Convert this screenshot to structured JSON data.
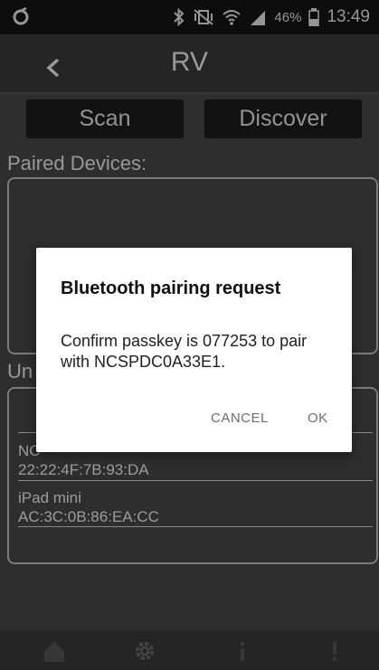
{
  "status_bar": {
    "battery_percent": "46%",
    "time": "13:49"
  },
  "header": {
    "title": "RV"
  },
  "buttons": {
    "scan": "Scan",
    "discover": "Discover"
  },
  "paired": {
    "label": "Paired Devices:"
  },
  "unpaired": {
    "label": "Un",
    "devices": [
      {
        "name": "NC",
        "address": "22:22:4F:7B:93:DA"
      },
      {
        "name": "iPad mini",
        "address": "AC:3C:0B:86:EA:CC"
      }
    ]
  },
  "dialog": {
    "title": "Bluetooth pairing request",
    "message": "Confirm passkey is 077253 to pair with NCSPDC0A33E1.",
    "cancel": "CANCEL",
    "ok": "OK"
  },
  "colors": {
    "app_background": "#474747",
    "status_bar": "#141414",
    "dialog_background": "#ffffff"
  },
  "icons": {
    "status_app": "app-notification-icon",
    "bluetooth": "bluetooth-icon",
    "mute": "vibrate-mute-icon",
    "wifi": "wifi-icon",
    "signal": "signal-icon",
    "battery": "battery-icon",
    "back": "back-arrow-icon",
    "nav": [
      "home-icon",
      "settings-gear-icon",
      "info-icon",
      "alert-icon"
    ]
  }
}
